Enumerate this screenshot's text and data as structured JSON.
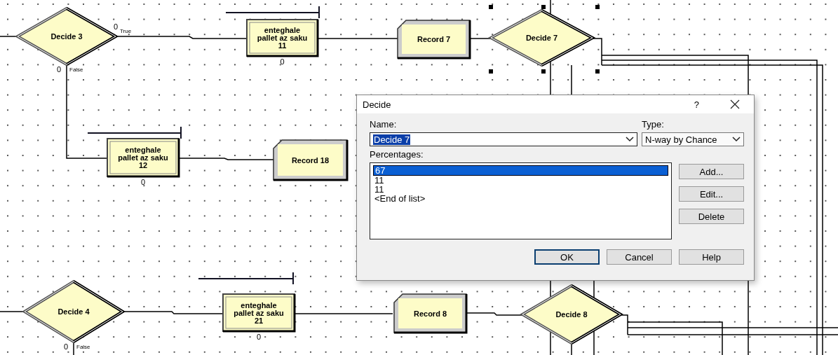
{
  "modules": [
    {
      "kind": "decide",
      "label": [
        "Decide 3"
      ],
      "true_count": "0",
      "true_label": "True",
      "false_count": "0",
      "false_label": "False"
    },
    {
      "kind": "process",
      "label": [
        "enteghale",
        "pallet az saku",
        "11"
      ],
      "count": "0"
    },
    {
      "kind": "record",
      "label": [
        "Record 7"
      ]
    },
    {
      "kind": "decide",
      "label": [
        "Decide 7"
      ]
    },
    {
      "kind": "process",
      "label": [
        "enteghale",
        "pallet az saku",
        "12"
      ],
      "count": "0"
    },
    {
      "kind": "record",
      "label": [
        "Record 18"
      ]
    },
    {
      "kind": "decide",
      "label": [
        "Decide 4"
      ],
      "false_count": "0",
      "false_label": "False"
    },
    {
      "kind": "process",
      "label": [
        "enteghale",
        "pallet az saku",
        "21"
      ],
      "count": "0"
    },
    {
      "kind": "record",
      "label": [
        "Record 8"
      ]
    },
    {
      "kind": "decide",
      "label": [
        "Decide 8"
      ]
    }
  ],
  "dialog": {
    "title": "Decide",
    "help": "?",
    "name_label": "Name:",
    "name_value": "Decide 7",
    "type_label": "Type:",
    "type_value": "N-way by Chance",
    "percentages_label": "Percentages:",
    "percentages": [
      {
        "text": "67",
        "selected": true
      },
      {
        "text": "11",
        "selected": false
      },
      {
        "text": "11",
        "selected": false
      },
      {
        "text": "<End of list>",
        "selected": false
      }
    ],
    "side_buttons": [
      "Add...",
      "Edit...",
      "Delete"
    ],
    "bottom_buttons": [
      {
        "label": "OK",
        "default": true
      },
      {
        "label": "Cancel",
        "default": false
      },
      {
        "label": "Help",
        "default": false
      }
    ]
  }
}
